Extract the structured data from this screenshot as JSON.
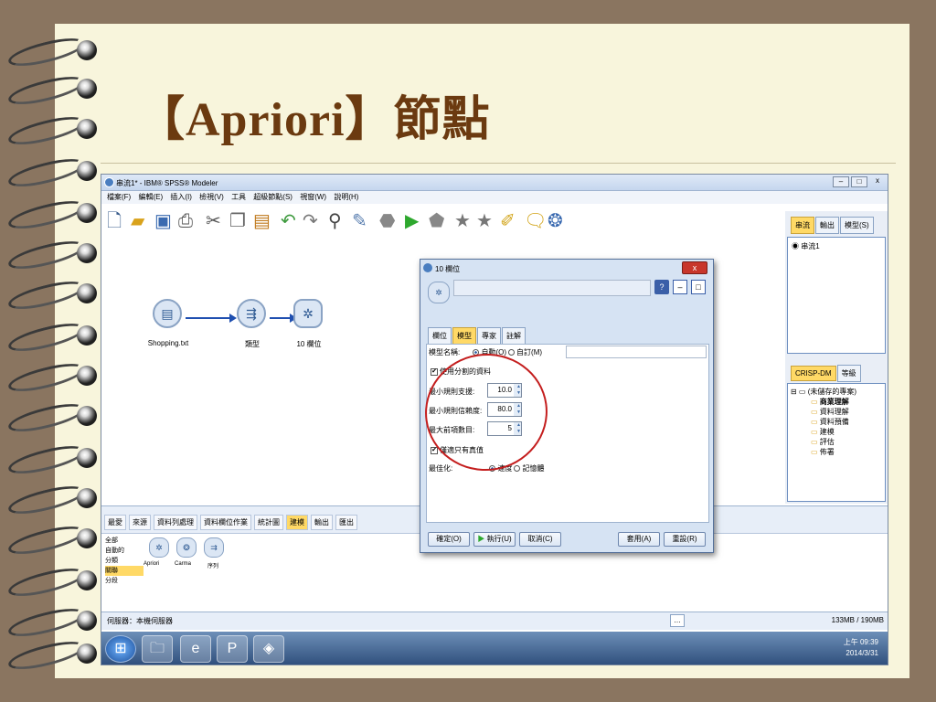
{
  "slide": {
    "title": "【Apriori】節點"
  },
  "app": {
    "window_title": "串流1* - IBM® SPSS® Modeler",
    "menu": [
      "檔案(F)",
      "編輯(E)",
      "插入(I)",
      "檢視(V)",
      "工具",
      "超級節點(S)",
      "視窗(W)",
      "說明(H)"
    ],
    "toolbar_icons": [
      "new-icon",
      "open-icon",
      "save-icon",
      "print-icon",
      "cut-icon",
      "copy-icon",
      "paste-icon",
      "undo-icon",
      "redo-icon",
      "find-icon",
      "edit-icon",
      "stop-icon",
      "run-icon",
      "run-selection-icon",
      "star-icon",
      "star-filled-icon",
      "annotate-icon",
      "comment-icon",
      "help-icon"
    ]
  },
  "canvas": {
    "nodes": [
      {
        "label": "Shopping.txt",
        "icon": "file-icon"
      },
      {
        "label": "類型",
        "icon": "type-icon"
      },
      {
        "label": "10 欄位",
        "icon": "apriori-icon"
      }
    ]
  },
  "side": {
    "top_tabs": [
      "串流",
      "輸出",
      "模型(S)"
    ],
    "stream_item": "串流1",
    "bottom_tabs": [
      "CRISP-DM",
      "等級"
    ],
    "tree_root": "(未儲存的專案)",
    "tree_items": [
      "商業理解",
      "資料理解",
      "資料預備",
      "建模",
      "評估",
      "佈署"
    ]
  },
  "palette": {
    "tabs": [
      "最愛",
      "來源",
      "資料列處理",
      "資料欄位作業",
      "統計圖",
      "建模",
      "輸出",
      "匯出"
    ],
    "active_tab": "建模",
    "categories": [
      "全部",
      "自動的",
      "分類",
      "關聯",
      "分段"
    ],
    "selected_category": "關聯",
    "nodes": [
      "Apriori",
      "Carma",
      "序列"
    ]
  },
  "status": {
    "server": "伺服器：本機伺服器",
    "memory": "133MB / 190MB"
  },
  "taskbar": {
    "time": "上午 09:39",
    "date": "2014/3/31"
  },
  "dialog": {
    "title": "10 欄位",
    "close_label": "x",
    "tabs": [
      "欄位",
      "模型",
      "專家",
      "註解"
    ],
    "active_tab": "模型",
    "model_name_label": "模型名稱:",
    "auto_option": "自動(O)",
    "custom_option": "自訂(M)",
    "use_partition_label": "使用分割的資料",
    "min_support_label": "最小規則支援:",
    "min_support_value": "10.0",
    "min_confidence_label": "最小規則信賴度:",
    "min_confidence_value": "80.0",
    "max_antecedents_label": "最大前項數目:",
    "max_antecedents_value": "5",
    "only_true_label": "僅適只有真值",
    "optimize_label": "最佳化:",
    "speed_option": "速度",
    "memory_option": "記憶體",
    "buttons": {
      "ok": "確定(O)",
      "run": "執行(U)",
      "cancel": "取消(C)",
      "apply": "套用(A)",
      "reset": "重設(R)"
    }
  }
}
